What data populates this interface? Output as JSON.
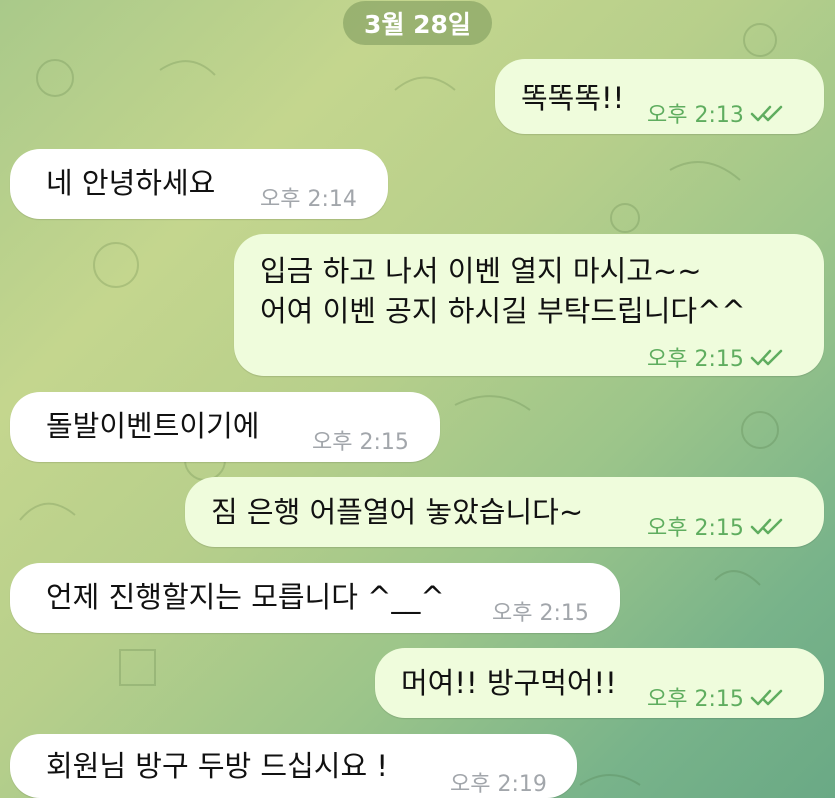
{
  "chat": {
    "date_chip": "3월 28일",
    "colors": {
      "incoming_bubble": "#ffffff",
      "outgoing_bubble": "#effcdc",
      "outgoing_meta": "#5fad5f",
      "incoming_meta": "#a2a6ab"
    },
    "messages": [
      {
        "direction": "outgoing",
        "lines": [
          "똑똑똑!!"
        ],
        "time": "오후 2:13",
        "status_icon": "double-check-icon"
      },
      {
        "direction": "incoming",
        "lines": [
          "네 안녕하세요"
        ],
        "time": "오후 2:14"
      },
      {
        "direction": "outgoing",
        "lines": [
          "입금 하고 나서 이벤 열지 마시고~~",
          "어여 이벤 공지 하시길 부탁드립니다^^"
        ],
        "time": "오후 2:15",
        "status_icon": "double-check-icon"
      },
      {
        "direction": "incoming",
        "lines": [
          "돌발이벤트이기에"
        ],
        "time": "오후 2:15"
      },
      {
        "direction": "outgoing",
        "lines": [
          "짐 은행 어플열어 놓았습니다~"
        ],
        "time": "오후 2:15",
        "status_icon": "double-check-icon"
      },
      {
        "direction": "incoming",
        "lines": [
          "언제 진행할지는 모릅니다 ^__^"
        ],
        "time": "오후 2:15"
      },
      {
        "direction": "outgoing",
        "lines": [
          "머여!! 방구먹어!!"
        ],
        "time": "오후 2:15",
        "status_icon": "double-check-icon"
      },
      {
        "direction": "incoming",
        "lines": [
          "회원님 방구 두방 드십시요 !"
        ],
        "time": "오후 2:19"
      }
    ]
  }
}
